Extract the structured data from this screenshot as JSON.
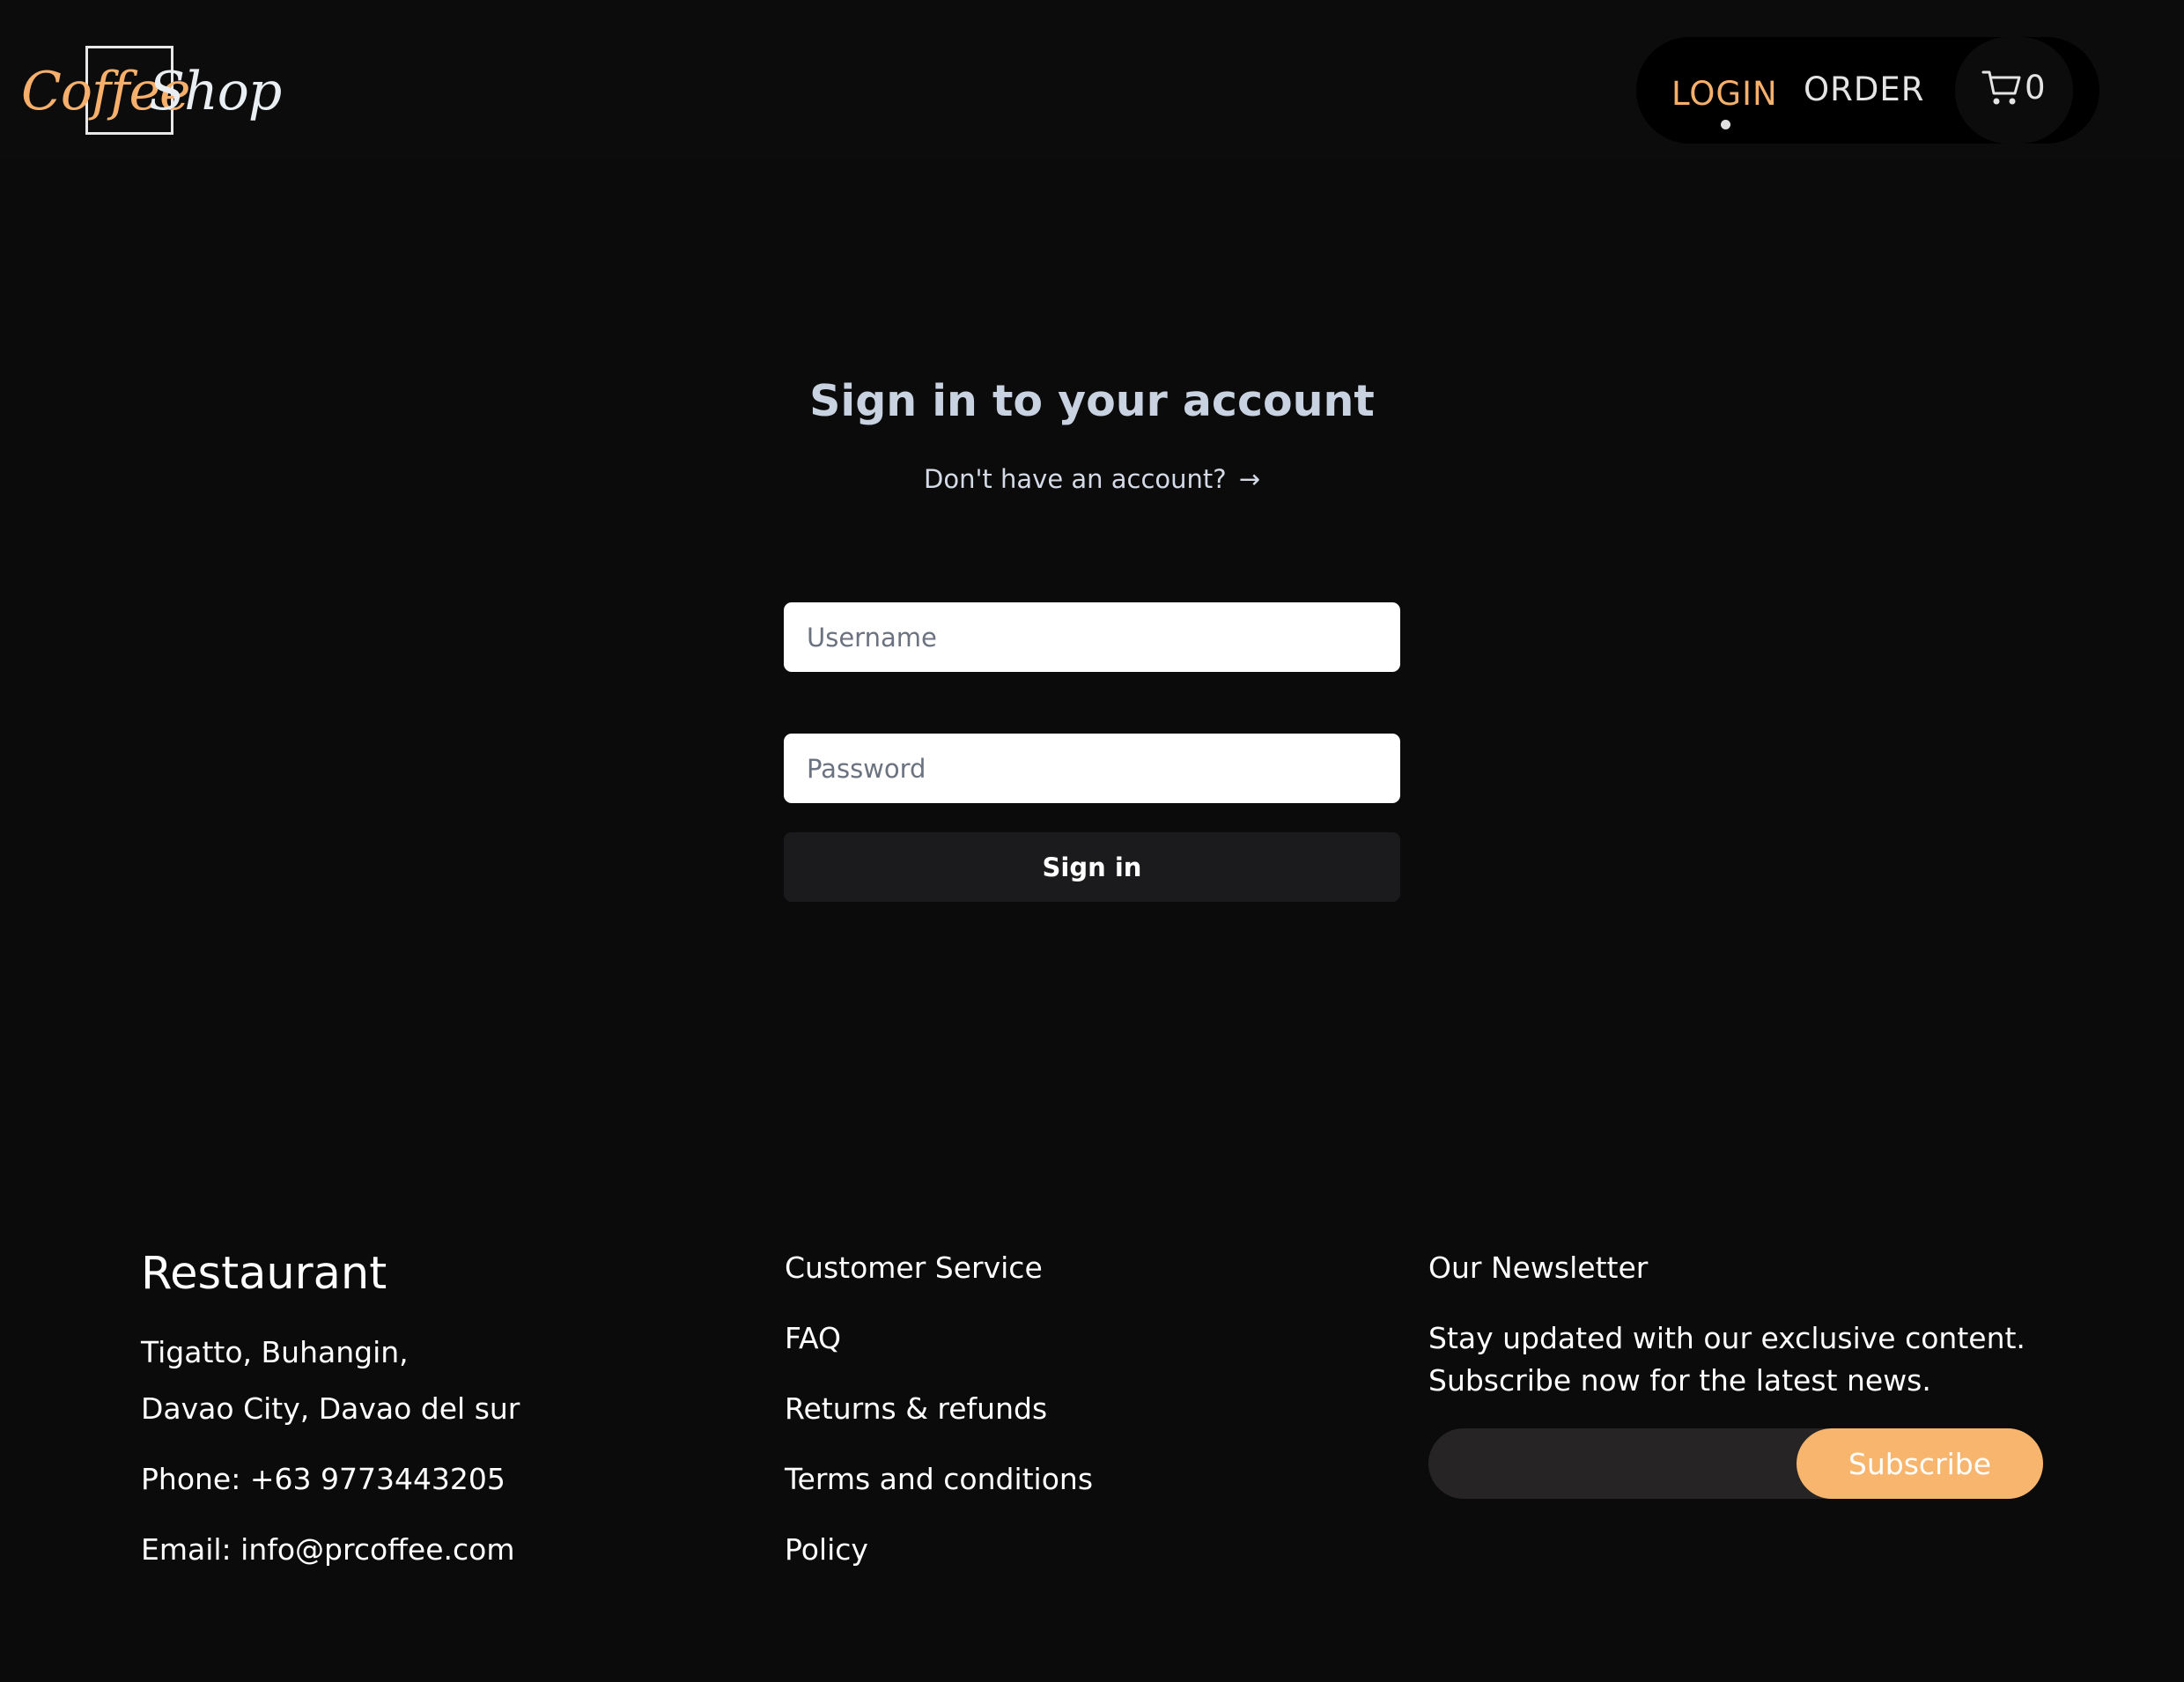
{
  "header": {
    "logo": {
      "word1": "Coffee",
      "word2": "Shop"
    },
    "nav": {
      "login": "LOGIN",
      "order": "ORDER"
    },
    "cart": {
      "icon": "cart-icon",
      "count": "0"
    }
  },
  "login": {
    "title": "Sign in to your account",
    "signup_link": "Don't have an account?",
    "signup_arrow": "→",
    "username_placeholder": "Username",
    "password_placeholder": "Password",
    "submit_label": "Sign in"
  },
  "footer": {
    "restaurant": {
      "heading": "Restaurant",
      "address_line1": "Tigatto, Buhangin,",
      "address_line2": "Davao City, Davao del sur",
      "phone": "Phone: +63 9773443205",
      "email": "Email: info@prcoffee.com"
    },
    "service": {
      "heading": "Customer Service",
      "links": [
        "FAQ",
        "Returns & refunds",
        "Terms and conditions",
        "Policy"
      ]
    },
    "newsletter": {
      "heading": "Our Newsletter",
      "line1": "Stay updated with our exclusive content.",
      "line2": "Subscribe now for the latest news.",
      "subscribe_label": "Subscribe"
    }
  },
  "colors": {
    "accent": "#f6b06b",
    "background": "#0b0b0b",
    "button_dark": "#1b1b1d",
    "subscribe": "#f8b56d"
  }
}
